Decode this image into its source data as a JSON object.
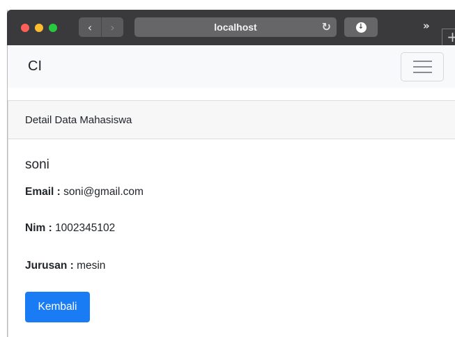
{
  "browser": {
    "address": "localhost",
    "back_icon": "‹",
    "forward_icon": "›",
    "reload_icon": "↻",
    "download_icon": "↓",
    "more_icon": "»",
    "new_tab_icon": "+"
  },
  "navbar": {
    "brand": "CI",
    "toggler_icon": "hamburger-icon"
  },
  "card": {
    "header": "Detail Data Mahasiswa",
    "name": "soni",
    "email_label": "Email :",
    "email_value": "soni@gmail.com",
    "nim_label": "Nim :",
    "nim_value": "1002345102",
    "jurusan_label": "Jurusan :",
    "jurusan_value": "mesin",
    "back_button": "Kembali"
  },
  "colors": {
    "primary": "#1a7cf5",
    "traffic_red": "#fe5f57",
    "traffic_yellow": "#febc2e",
    "traffic_green": "#28c840"
  }
}
